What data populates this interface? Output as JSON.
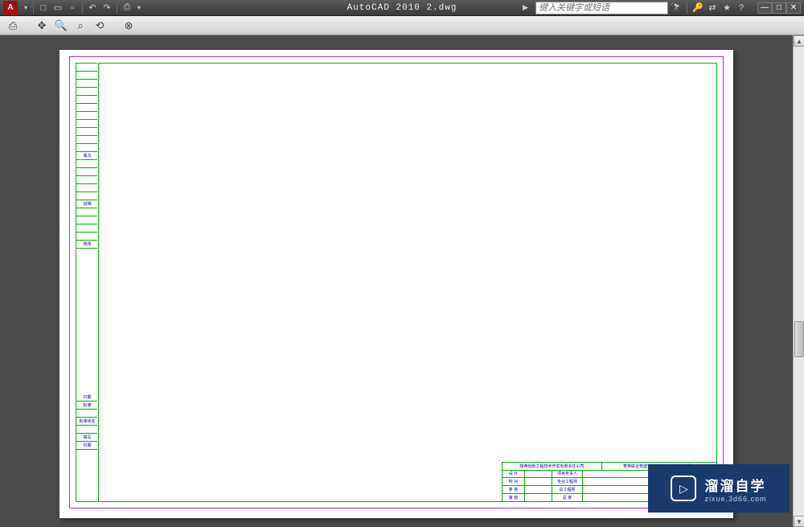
{
  "titlebar": {
    "app_title": "AutoCAD 2010  2.dwg",
    "search_placeholder": "键入关键字或短语"
  },
  "qat": {
    "new": "□",
    "open": "▭",
    "save": "▫",
    "undo": "↶",
    "redo": "↷",
    "print": "⎙"
  },
  "right_tools": {
    "binoculars": "🔭",
    "key": "🔑",
    "exchange": "⇄",
    "star": "★",
    "help": "?"
  },
  "window_controls": {
    "min": "—",
    "max": "□",
    "close": "✕"
  },
  "toolbar": {
    "plot": "⎙",
    "pan": "✥",
    "zoom": "🔍",
    "zoom_window": "⌕",
    "zoom_prev": "⟲",
    "close_preview": "⊗"
  },
  "drawing": {
    "rev_labels": [
      "版次",
      "说明",
      "修改",
      "日期",
      "批准",
      "批准状态",
      "填写",
      "日期"
    ],
    "titleblock": {
      "company": "陕西怡帆工程技术开发有限责任公司",
      "project": "育英联合党建实训中心（示范）建设项目",
      "rows": [
        {
          "l1": "设 计",
          "l2": "",
          "l3": "项目负责人",
          "l4": ""
        },
        {
          "l1": "校 对",
          "l2": "",
          "l3": "专业工程师",
          "l4": ""
        },
        {
          "l1": "复 核",
          "l2": "",
          "l3": "总工程师",
          "l4": ""
        },
        {
          "l1": "审 核",
          "l2": "",
          "l3": "总 审",
          "l4": ""
        }
      ]
    }
  },
  "watermark": {
    "main": "溜溜自学",
    "sub": "zixue.3d66.com",
    "play": "▷"
  }
}
